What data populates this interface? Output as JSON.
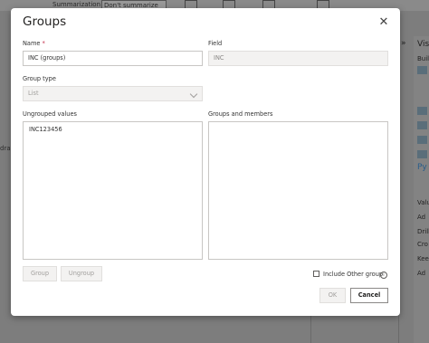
{
  "background": {
    "summarization_label": "Summarization",
    "summarization_value": "Don't summarize",
    "left_fragment": "dra",
    "right_pane": {
      "title_fragment": "Vis",
      "build_fragment": "Buil",
      "py_fragment": "Py",
      "values_fragment": "Valu",
      "add_fragment": "Ad",
      "drill_fragment": "Drill",
      "cross_fragment": "Cro",
      "keep_fragment": "Kee",
      "add2_fragment": "Ad"
    },
    "collapse_glyph": "»"
  },
  "dialog": {
    "title": "Groups",
    "close_glyph": "✕",
    "name_label": "Name",
    "required_mark": "*",
    "name_value": "INC (groups)",
    "field_label": "Field",
    "field_value": "INC",
    "group_type_label": "Group type",
    "group_type_value": "List",
    "ungrouped_label": "Ungrouped values",
    "ungrouped_values": [
      "INC123456"
    ],
    "groups_members_label": "Groups and members",
    "group_button": "Group",
    "ungroup_button": "Ungroup",
    "include_other_label": "Include Other group",
    "include_other_checked": false,
    "info_glyph": "i",
    "ok_button": "OK",
    "cancel_button": "Cancel"
  }
}
